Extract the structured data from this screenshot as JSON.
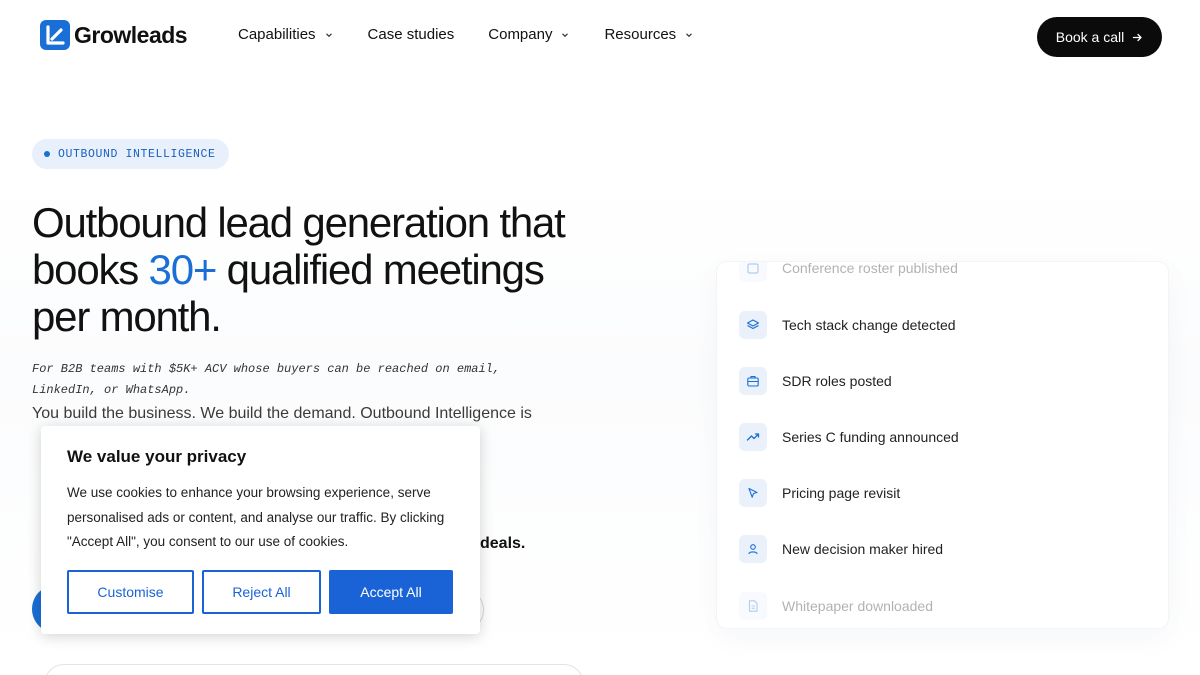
{
  "brand": {
    "name": "Growleads",
    "accent": "#1a6fd6"
  },
  "nav": {
    "items": [
      {
        "label": "Capabilities",
        "has_dropdown": true
      },
      {
        "label": "Case studies",
        "has_dropdown": false
      },
      {
        "label": "Company",
        "has_dropdown": true
      },
      {
        "label": "Resources",
        "has_dropdown": true
      }
    ],
    "cta_label": "Book a call"
  },
  "hero": {
    "eyebrow": "OUTBOUND INTELLIGENCE",
    "headline_pre": "Outbound lead generation that books ",
    "headline_accent": "30+",
    "headline_post": " qualified meetings per month.",
    "tagline": "For B2B teams with $5K+ ACV whose buyers can be reached on email, LinkedIn, or WhatsApp.",
    "body_visible": "You build the business. We build the demand. Outbound Intelligence is",
    "body_bold_tail": "deals."
  },
  "signals": {
    "items": [
      {
        "label": "Conference roster published",
        "icon": "calendar-icon",
        "faded": true
      },
      {
        "label": "Tech stack change detected",
        "icon": "layers-icon",
        "faded": false
      },
      {
        "label": "SDR roles posted",
        "icon": "briefcase-icon",
        "faded": false
      },
      {
        "label": "Series C funding announced",
        "icon": "trending-up-icon",
        "faded": false
      },
      {
        "label": "Pricing page revisit",
        "icon": "cursor-icon",
        "faded": false
      },
      {
        "label": "New decision maker hired",
        "icon": "user-icon",
        "faded": false
      },
      {
        "label": "Whitepaper downloaded",
        "icon": "document-icon",
        "faded": true
      }
    ]
  },
  "cookie": {
    "title": "We value your privacy",
    "message": "We use cookies to enhance your browsing experience, serve personalised ads or content, and analyse our traffic. By clicking \"Accept All\", you consent to our use of cookies.",
    "customise_label": "Customise",
    "reject_label": "Reject All",
    "accept_label": "Accept All",
    "button_color": "#1a63d6"
  }
}
